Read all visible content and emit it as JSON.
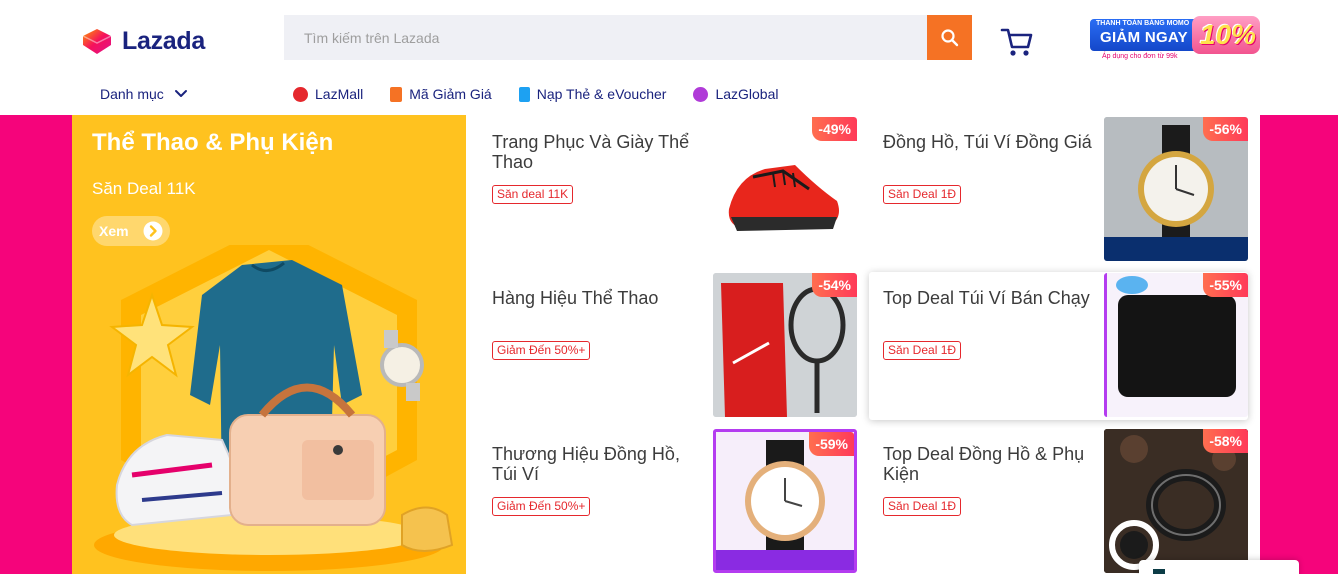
{
  "header": {
    "logo_text": "Lazada",
    "search_placeholder": "Tìm kiếm trên Lazada",
    "category_label": "Danh mục",
    "promo": {
      "top_text": "THANH TOÁN BẰNG MOMO",
      "main_text": "GIẢM NGAY",
      "percent": "10%",
      "sub_text": "Áp dụng cho đơn từ 99k"
    }
  },
  "nav": [
    {
      "label": "LazMall",
      "icon": "lazmall-icon",
      "color": "#e5282d"
    },
    {
      "label": "Mã Giảm Giá",
      "icon": "voucher-icon",
      "color": "#f57224"
    },
    {
      "label": "Nạp Thẻ & eVoucher",
      "icon": "topup-icon",
      "color": "#1da1f2"
    },
    {
      "label": "LazGlobal",
      "icon": "globe-icon",
      "color": "#b03bd8"
    }
  ],
  "banner": {
    "title": "Thể Thao & Phụ Kiện",
    "subtitle": "Săn Deal 11K",
    "button_label": "Xem"
  },
  "cards": [
    {
      "title": "Trang Phục Và Giày Thể Thao",
      "tag": "Săn deal 11K",
      "discount": "-49%"
    },
    {
      "title": "Đồng Hồ, Túi Ví Đồng Giá",
      "tag": "Săn Deal 1Đ",
      "discount": "-56%"
    },
    {
      "title": "Hàng Hiệu Thể Thao",
      "tag": "Giảm Đến 50%+",
      "discount": "-54%"
    },
    {
      "title": "Top Deal Túi Ví Bán Chạy",
      "tag": "Săn Deal 1Đ",
      "discount": "-55%"
    },
    {
      "title": "Thương Hiệu Đồng Hồ, Túi Ví",
      "tag": "Giảm Đến 50%+",
      "discount": "-59%"
    },
    {
      "title": "Top Deal Đồng Hồ & Phụ Kiện",
      "tag": "Săn Deal 1Đ",
      "discount": "-58%"
    }
  ],
  "colors": {
    "brand_orange": "#f57224",
    "brand_navy": "#1a237e",
    "band_pink": "#f5047b",
    "banner_yellow": "#ffc21f",
    "tag_red": "#e5282d"
  }
}
